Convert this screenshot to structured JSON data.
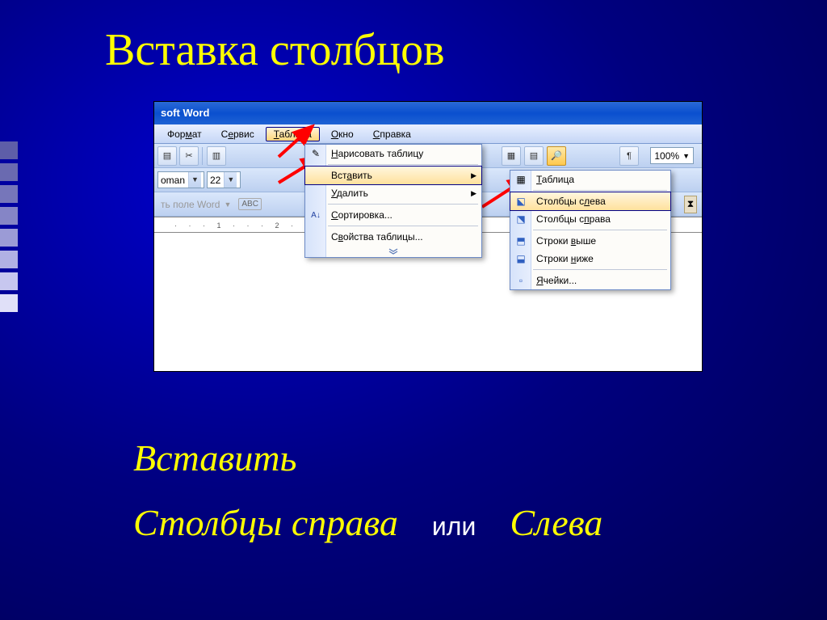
{
  "slide": {
    "title": "Вставка столбцов",
    "caption_insert": "Вставить",
    "caption_right": "Столбцы справа",
    "caption_or": "или",
    "caption_left": "Слева"
  },
  "side_colors": [
    "#5e5ea8",
    "#6a6ab0",
    "#7676ba",
    "#8585c6",
    "#9b9bd6",
    "#b1b1e4",
    "#c7c7ef",
    "#e0e0f8"
  ],
  "titlebar": {
    "text": "soft Word"
  },
  "menubar": {
    "items": [
      {
        "label": "Формат",
        "u": ""
      },
      {
        "label": "Сервис",
        "u": ""
      },
      {
        "label": "Таблица",
        "u": "Т",
        "selected": true
      },
      {
        "label": "Окно",
        "u": "О"
      },
      {
        "label": "Справка",
        "u": "С"
      }
    ]
  },
  "toolbar1": {
    "zoom": "100%"
  },
  "toolbar2": {
    "font": "oman",
    "size": "22"
  },
  "toolbar3": {
    "label": "ть поле Word"
  },
  "ruler": "· · · 1 · · · 2 ·",
  "menu_table": {
    "items": [
      {
        "label": "Нарисовать таблицу",
        "icon": "✎",
        "u": "Н"
      },
      {
        "label": "Вставить",
        "u": "а",
        "arrow": true,
        "highlight": true
      },
      {
        "label": "Удалить",
        "u": "У",
        "arrow": true
      },
      {
        "label": "Сортировка...",
        "icon": "А↓",
        "u": "С"
      },
      {
        "label": "Свойства таблицы...",
        "u": "в"
      }
    ]
  },
  "menu_insert": {
    "items": [
      {
        "label": "Таблица",
        "icon": "▦",
        "u": "Т"
      },
      {
        "label": "Столбцы слева",
        "icon": "⬕",
        "u": "л",
        "highlight": true
      },
      {
        "label": "Столбцы справа",
        "icon": "⬔",
        "u": "п"
      },
      {
        "label": "Строки выше",
        "icon": "⬒",
        "u": "в"
      },
      {
        "label": "Строки ниже",
        "icon": "⬓",
        "u": "н"
      },
      {
        "label": "Ячейки...",
        "icon": "▫",
        "u": "Я"
      }
    ]
  }
}
